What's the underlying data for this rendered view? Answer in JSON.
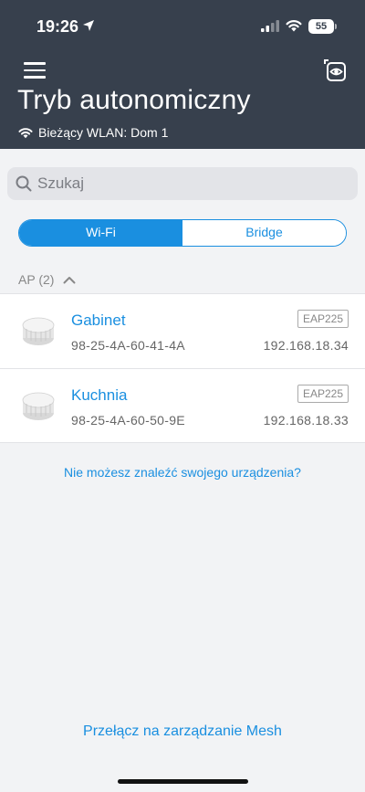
{
  "status_bar": {
    "time": "19:26",
    "battery": "55"
  },
  "header": {
    "title": "Tryb autonomiczny",
    "wlan": "Bieżący WLAN: Dom 1"
  },
  "search": {
    "placeholder": "Szukaj",
    "value": ""
  },
  "segments": [
    {
      "label": "Wi-Fi",
      "active": true
    },
    {
      "label": "Bridge",
      "active": false
    }
  ],
  "section": {
    "label": "AP (2)"
  },
  "devices": [
    {
      "name": "Gabinet",
      "mac": "98-25-4A-60-41-4A",
      "model": "EAP225",
      "ip": "192.168.18.34"
    },
    {
      "name": "Kuchnia",
      "mac": "98-25-4A-60-50-9E",
      "model": "EAP225",
      "ip": "192.168.18.33"
    }
  ],
  "links": {
    "cant_find": "Nie możesz znaleźć swojego urządzenia?",
    "switch_mesh": "Przełącz na zarządzanie Mesh"
  },
  "colors": {
    "header_bg": "#37404d",
    "accent": "#1a8fe0",
    "background": "#f2f3f5"
  },
  "icons": [
    "location-arrow-icon",
    "cellular-signal-icon",
    "wifi-icon",
    "battery-icon",
    "hamburger-menu-icon",
    "view-mode-icon",
    "search-icon",
    "chevron-up-icon",
    "access-point-icon"
  ]
}
